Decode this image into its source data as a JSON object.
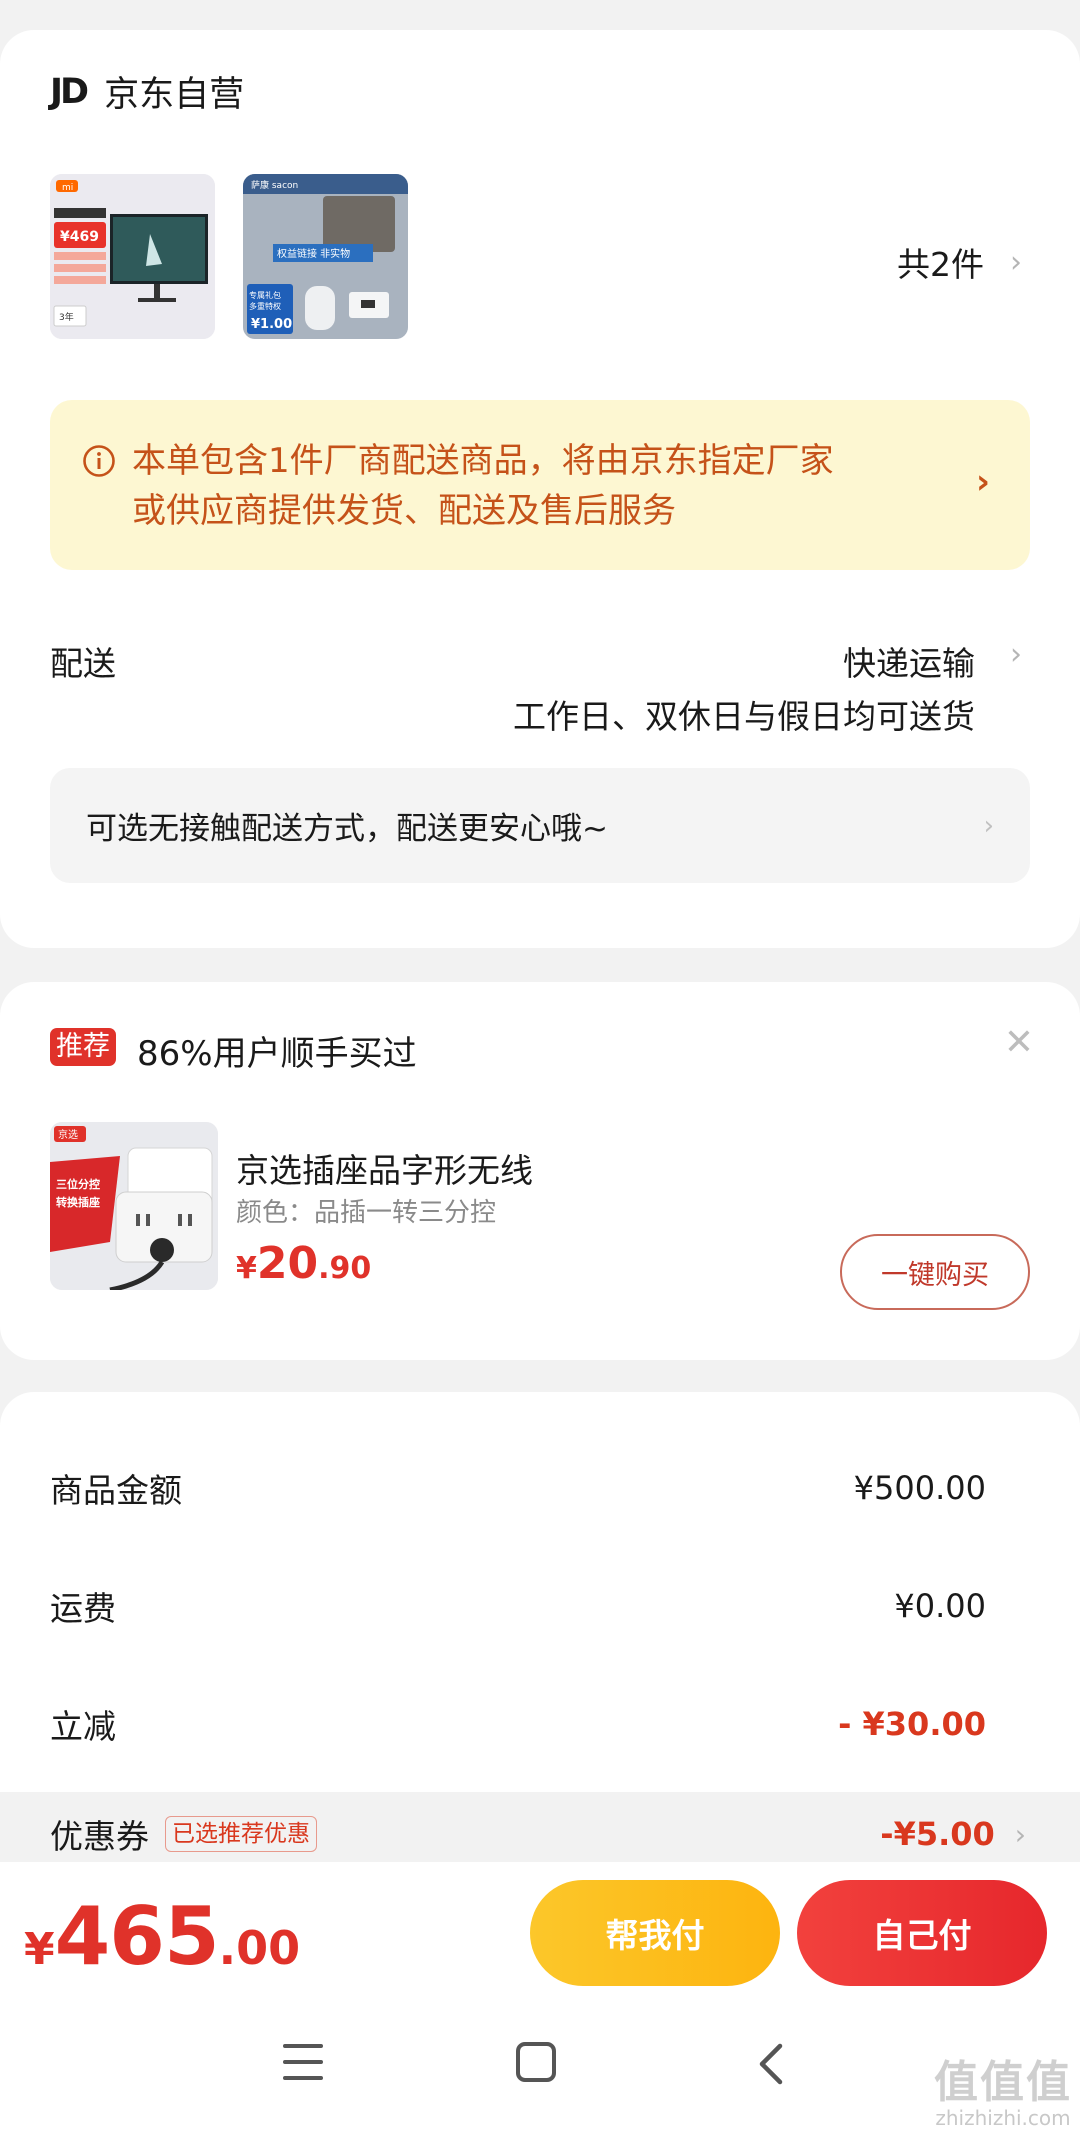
{
  "store": {
    "logo": "JD",
    "name": "京东自营",
    "product_count": "共2件",
    "thumb1": {
      "brand": "mi",
      "price": "¥469",
      "warranty": "3年"
    },
    "thumb2": {
      "brand": "萨康 sacon",
      "tag": "权益链接  非实物",
      "label1": "专属礼包",
      "label2": "多重特权",
      "price": "¥1.00"
    }
  },
  "notice": {
    "line1": "本单包含1件厂商配送商品，将由京东指定厂家",
    "line2": "或供应商提供发货、配送及售后服务"
  },
  "shipping": {
    "label": "配送",
    "method": "快递运输",
    "time": "工作日、双休日与假日均可送货",
    "contactless": "可选无接触配送方式，配送更安心哦~"
  },
  "recommend": {
    "badge": "推荐",
    "title": "86%用户顺手买过",
    "img_brand": "京选",
    "img_text1": "三位分控",
    "img_text2": "转换插座",
    "product_name": "京选插座品字形无线",
    "spec": "颜色：品插一转三分控",
    "price_symbol": "¥",
    "price_int": "20",
    "price_dec": ".90",
    "buy_button": "一键购买"
  },
  "summary": {
    "goods_label": "商品金额",
    "goods_value": "¥500.00",
    "freight_label": "运费",
    "freight_value": "¥0.00",
    "discount_label": "立减",
    "discount_value": "- ¥30.00",
    "coupon_label": "优惠券",
    "coupon_tag": "已选推荐优惠",
    "coupon_value": "-¥5.00"
  },
  "bottom": {
    "total_symbol": "¥",
    "total_int": "465",
    "total_dec": ".00",
    "help_pay": "帮我付",
    "self_pay": "自己付"
  },
  "watermark": {
    "logo": "值值值",
    "url": "zhizhizhi.com"
  },
  "colors": {
    "accent_red": "#e0322a",
    "notice_bg": "#fdf7d2",
    "notice_text": "#c55219",
    "help_yellow": "#fdb40f"
  }
}
